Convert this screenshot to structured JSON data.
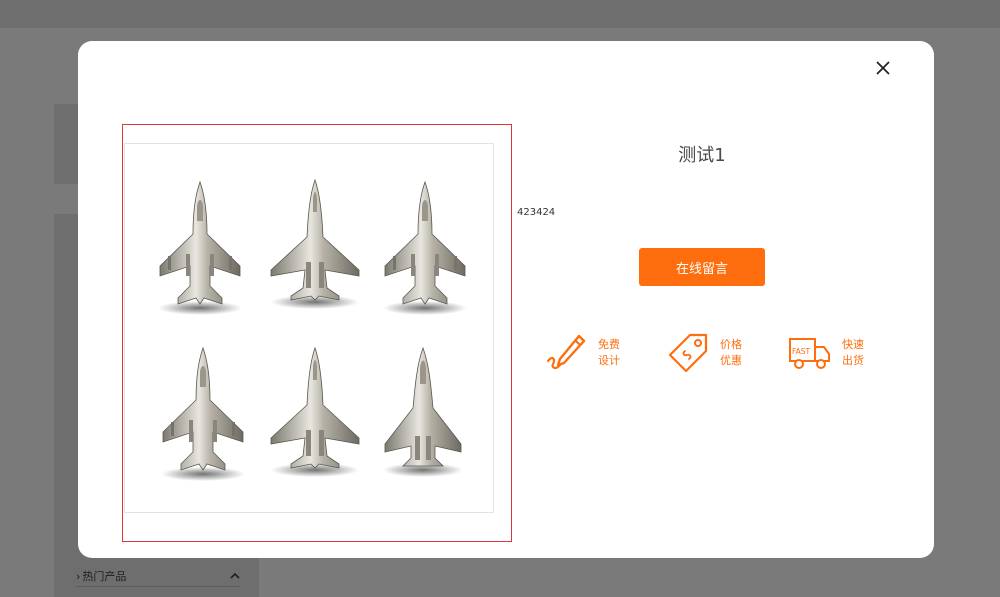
{
  "background": {
    "sidebar_section_label": "热门产品"
  },
  "modal": {
    "product_title": "测试1",
    "product_code": "423424",
    "message_button_label": "在线留言",
    "features": [
      {
        "icon": "pen-icon",
        "line1": "免费",
        "line2": "设计"
      },
      {
        "icon": "price-tag-icon",
        "line1": "价格",
        "line2": "优惠"
      },
      {
        "icon": "fast-truck-icon",
        "line1": "快速",
        "line2": "出货",
        "icon_text": "FAST"
      }
    ]
  },
  "colors": {
    "accent": "#ff6e0e",
    "image_frame_border": "#d83a3a"
  }
}
